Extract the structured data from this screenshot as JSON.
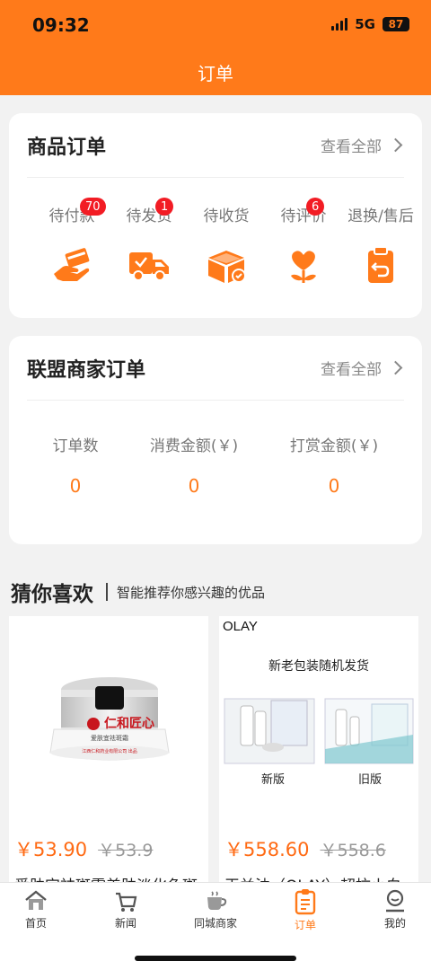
{
  "status_bar": {
    "time": "09:32",
    "network": "5G",
    "battery": "87"
  },
  "header": {
    "title": "订单"
  },
  "goods_orders": {
    "title": "商品订单",
    "view_all": "查看全部",
    "items": [
      {
        "label": "待付款",
        "badge": "70",
        "icon": "payment-hand-card-icon"
      },
      {
        "label": "待发货",
        "badge": "1",
        "icon": "delivery-truck-icon"
      },
      {
        "label": "待收货",
        "badge": "",
        "icon": "open-box-icon"
      },
      {
        "label": "待评价",
        "badge": "6",
        "icon": "heart-flower-icon"
      },
      {
        "label": "退换/售后",
        "badge": "",
        "icon": "return-clipboard-icon"
      }
    ]
  },
  "alliance_orders": {
    "title": "联盟商家订单",
    "view_all": "查看全部",
    "stats": [
      {
        "label": "订单数",
        "value": "0"
      },
      {
        "label": "消费金额(￥)",
        "value": "0"
      },
      {
        "label": "打赏金额(￥)",
        "value": "0"
      }
    ]
  },
  "recommend": {
    "title": "猜你喜欢",
    "subtitle": "智能推荐你感兴趣的优品",
    "products": [
      {
        "price": "￥53.90",
        "old_price": "￥53.9",
        "name": "爱肤宜祛斑霜美肤淡化色斑",
        "brand_mark": "仁和匠心",
        "product_line": "爱肤宜祛斑霜",
        "maker": "江西仁和药业有限公司 出品"
      },
      {
        "price": "￥558.60",
        "old_price": "￥558.6",
        "name": "玉兰油（OLAY）超抗小白",
        "brand": "OLAY",
        "banner": "新老包装随机发货",
        "new_label": "新版",
        "old_label": "旧版"
      }
    ]
  },
  "tabbar": {
    "active": "订单",
    "tabs": [
      {
        "label": "首页",
        "icon": "home-icon"
      },
      {
        "label": "新闻",
        "icon": "cart-icon"
      },
      {
        "label": "同城商家",
        "icon": "coffee-cup-icon"
      },
      {
        "label": "订单",
        "icon": "order-list-icon"
      },
      {
        "label": "我的",
        "icon": "user-icon"
      }
    ]
  },
  "colors": {
    "accent": "#ff7a1a",
    "badge": "#f21c24",
    "price": "#ff6a13"
  }
}
